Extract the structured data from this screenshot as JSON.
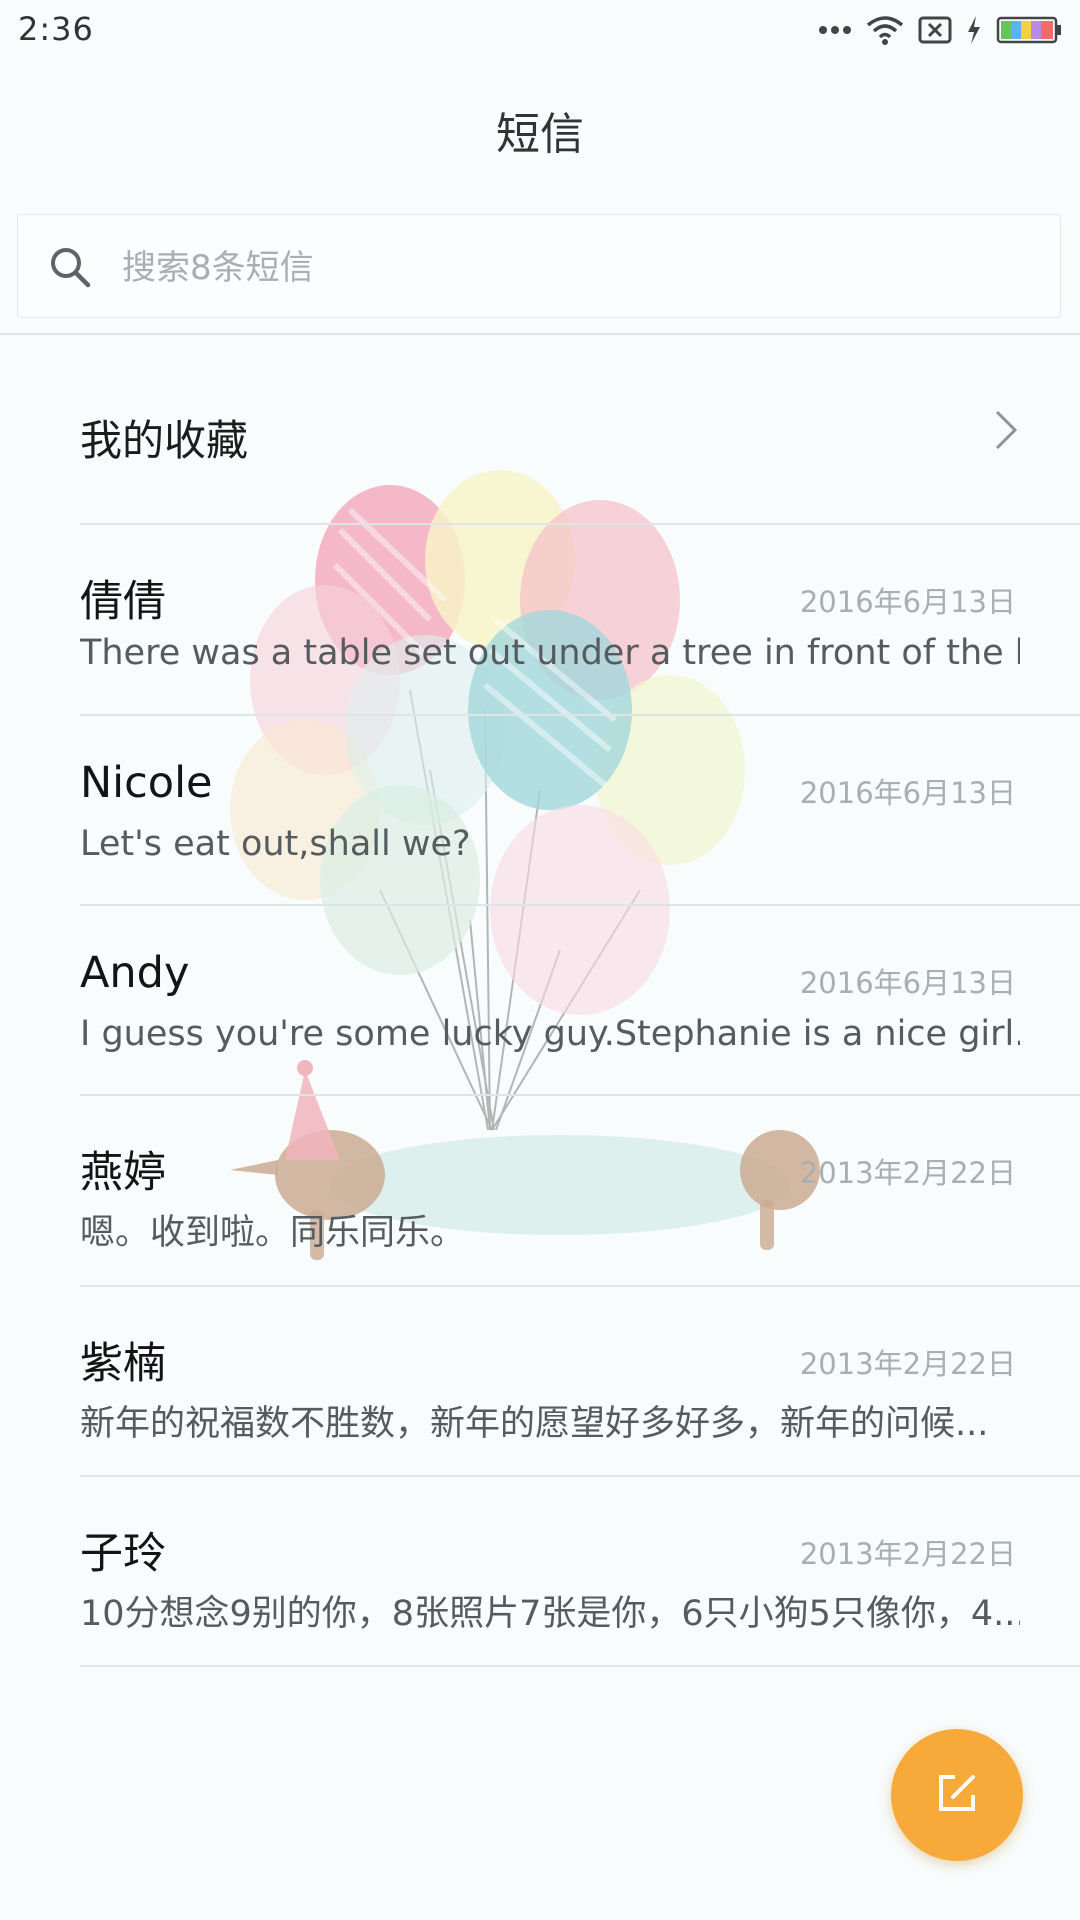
{
  "status_bar": {
    "time": "2:36"
  },
  "header": {
    "title": "短信"
  },
  "search": {
    "placeholder": "搜索8条短信",
    "value": ""
  },
  "favorites": {
    "label": "我的收藏"
  },
  "conversations": [
    {
      "name": "倩倩",
      "date": "2016年6月13日",
      "snippet": "There was a table set out under a tree in front of the ho..."
    },
    {
      "name": "Nicole",
      "date": "2016年6月13日",
      "snippet": "Let's eat out,shall we?"
    },
    {
      "name": "Andy",
      "date": "2016年6月13日",
      "snippet": "I guess you're some lucky guy.Stephanie is a nice girl."
    },
    {
      "name": "燕婷",
      "date": "2013年2月22日",
      "snippet": "嗯。收到啦。同乐同乐。"
    },
    {
      "name": "紫楠",
      "date": "2013年2月22日",
      "snippet": "新年的祝福数不胜数，新年的愿望好多好多，新年的问候..."
    },
    {
      "name": "子玲",
      "date": "2013年2月22日",
      "snippet": "10分想念9别的你，8张照片7张是你，6只小狗5只像你，4..."
    }
  ],
  "colors": {
    "accent": "#f7a939",
    "background": "#f8fcfd"
  },
  "icons": {
    "search": "search-icon",
    "chevron": "chevron-right-icon",
    "compose": "compose-icon"
  }
}
